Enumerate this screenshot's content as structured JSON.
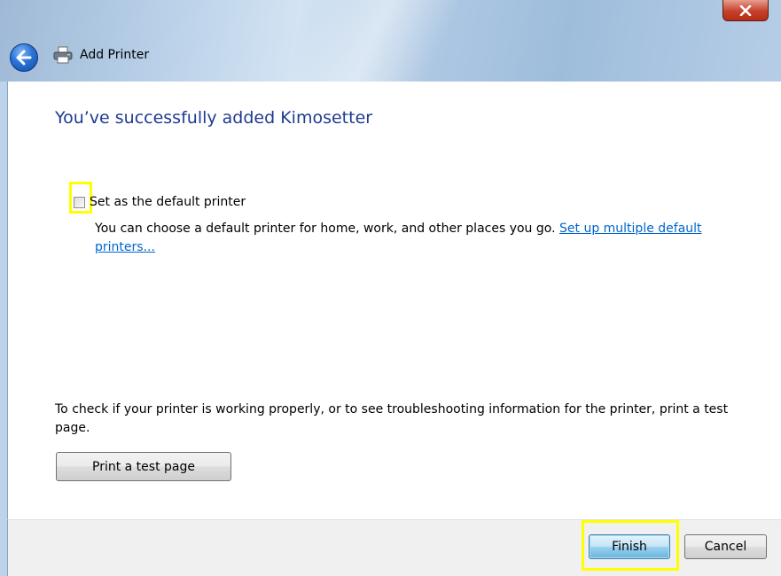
{
  "window": {
    "title": "Add Printer",
    "close_label": "x"
  },
  "page": {
    "heading": "You’ve successfully added Kimosetter",
    "default_printer": {
      "checkbox_label": "Set as the default printer",
      "checked": false,
      "description": "You can choose a default printer for home, work, and other places you go.",
      "link_text": "Set up multiple default printers..."
    },
    "test_page": {
      "text": "To check if your printer is working properly, or to see troubleshooting information for the printer, print a test page.",
      "button_label": "Print a test page"
    }
  },
  "footer": {
    "finish_label": "Finish",
    "cancel_label": "Cancel"
  },
  "colors": {
    "heading": "#1e3b91",
    "link": "#0066cc",
    "highlight": "#ffff00",
    "close_button": "#c7402a"
  },
  "icons": {
    "back": "back-arrow-icon",
    "printer": "printer-icon",
    "close": "close-icon"
  }
}
